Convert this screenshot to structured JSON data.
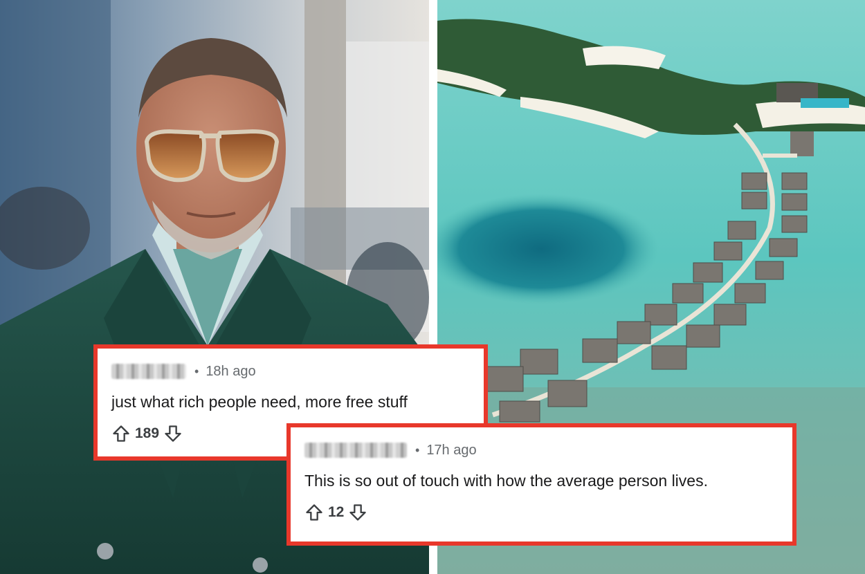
{
  "comments": [
    {
      "username": "",
      "username_obscured": true,
      "time": "18h ago",
      "text": "just what rich people need, more free stuff",
      "score": "189"
    },
    {
      "username": "",
      "username_obscured": true,
      "time": "17h ago",
      "text": "This is so out of touch with how the average person lives.",
      "score": "12"
    }
  ],
  "colors": {
    "card_border": "#e8382b",
    "meta_text": "#666a6e",
    "body_text": "#1a1a1b",
    "lagoon": "#5cc6bf",
    "blazer": "#1f4a42"
  },
  "icons": [
    "upvote-icon",
    "downvote-icon",
    "meta-separator-dot"
  ]
}
